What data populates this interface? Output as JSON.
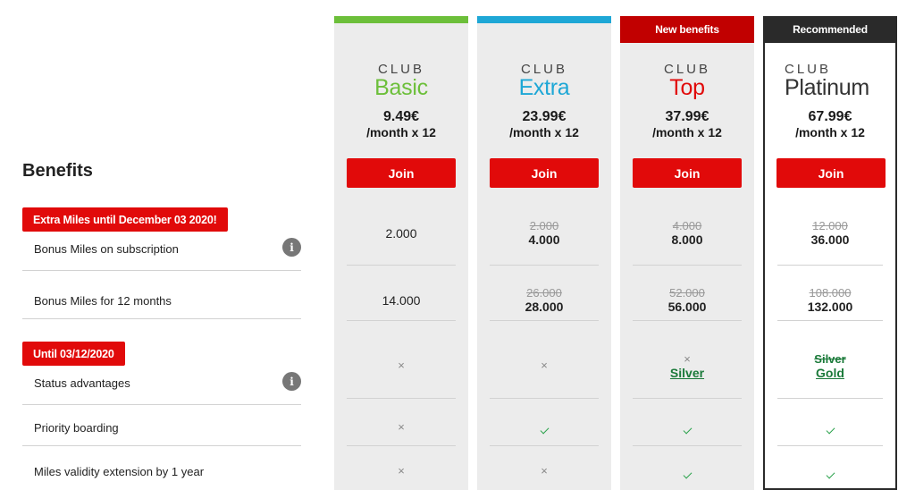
{
  "benefits_heading": "Benefits",
  "join_label": "Join",
  "logo_club": "CLUB",
  "promos": {
    "extra_miles": "Extra Miles until December 03 2020!",
    "until": "Until 03/12/2020"
  },
  "rows": {
    "bonus_subscription": "Bonus Miles on subscription",
    "bonus_12_months": "Bonus Miles for 12 months",
    "status_advantages": "Status advantages",
    "priority_boarding": "Priority boarding",
    "miles_validity": "Miles validity extension by 1 year"
  },
  "plans": {
    "basic": {
      "name": "Basic",
      "color": "#6cbf3a",
      "price": "9.49€",
      "period": "/month x 12",
      "subscription": "2.000",
      "twelve": "14.000",
      "status": "×",
      "priority": "×",
      "validity": "×"
    },
    "extra": {
      "name": "Extra",
      "color": "#1ea7d6",
      "price": "23.99€",
      "period": "/month x 12",
      "subscription_old": "2.000",
      "subscription": "4.000",
      "twelve_old": "26.000",
      "twelve": "28.000",
      "status": "×",
      "priority": "check",
      "validity": "×"
    },
    "top": {
      "name": "Top",
      "color": "#e10a0a",
      "tag": "New benefits",
      "tag_color": "#c10000",
      "price": "37.99€",
      "period": "/month x 12",
      "subscription_old": "4.000",
      "subscription": "8.000",
      "twelve_old": "52.000",
      "twelve": "56.000",
      "status_old": "×",
      "status": "Silver",
      "priority": "check",
      "validity": "check"
    },
    "platinum": {
      "name": "Platinum",
      "color": "#2a2a2a",
      "tag": "Recommended",
      "tag_color": "#2a2a2a",
      "price": "67.99€",
      "period": "/month x 12",
      "subscription_old": "12.000",
      "subscription": "36.000",
      "twelve_old": "108.000",
      "twelve": "132.000",
      "status_old": "Silver",
      "status": "Gold",
      "priority": "check",
      "validity": "check"
    }
  },
  "info_icon_glyph": "i"
}
